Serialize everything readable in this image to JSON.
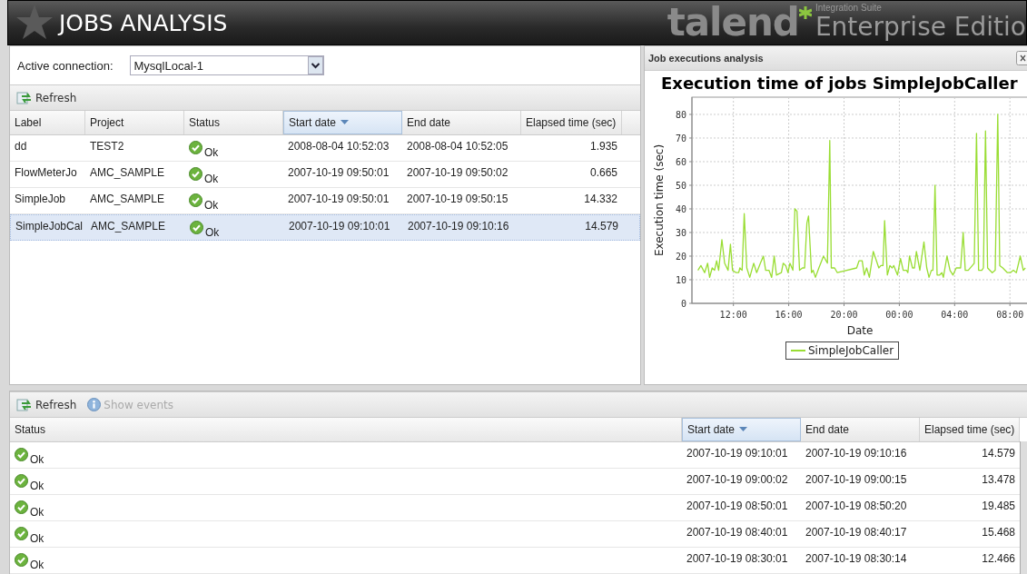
{
  "header": {
    "title": "JOBS ANALYSIS",
    "logo_word": "talend",
    "logo_suite": "Integration Suite",
    "logo_edition": "Enterprise Editio"
  },
  "connection": {
    "label": "Active connection:",
    "value": "MysqlLocal-1"
  },
  "jobs_toolbar": {
    "refresh": "Refresh"
  },
  "jobs_table": {
    "columns": [
      {
        "label": "Label",
        "sorted": false
      },
      {
        "label": "Project",
        "sorted": false
      },
      {
        "label": "Status",
        "sorted": false
      },
      {
        "label": "Start date",
        "sorted": true
      },
      {
        "label": "End date",
        "sorted": false
      },
      {
        "label": "Elapsed time (sec)",
        "sorted": false
      }
    ],
    "rows": [
      {
        "cells": [
          "dd",
          "TEST2",
          "Ok",
          "2008-08-04 10:52:03",
          "2008-08-04 10:52:05",
          "1.935"
        ],
        "selected": false
      },
      {
        "cells": [
          "FlowMeterJo",
          "AMC_SAMPLE",
          "Ok",
          "2007-10-19 09:50:01",
          "2007-10-19 09:50:02",
          "0.665"
        ],
        "selected": false
      },
      {
        "cells": [
          "SimpleJob",
          "AMC_SAMPLE",
          "Ok",
          "2007-10-19 09:50:01",
          "2007-10-19 09:50:15",
          "14.332"
        ],
        "selected": false
      },
      {
        "cells": [
          "SimpleJobCal",
          "AMC_SAMPLE",
          "Ok",
          "2007-10-19 09:10:01",
          "2007-10-19 09:10:16",
          "14.579"
        ],
        "selected": true
      }
    ]
  },
  "chart_panel": {
    "title": "Job executions analysis",
    "chart_data": {
      "type": "line",
      "title": "Execution time of jobs SimpleJobCaller",
      "xlabel": "Date",
      "ylabel": "Execution time (sec)",
      "grid": true,
      "xlim": [
        "2007-10-18 09:00",
        "2007-10-19 09:18"
      ],
      "ylim": [
        0,
        87.3
      ],
      "xticks": [
        {
          "value": "2007-10-18 12:00",
          "label": "12:00"
        },
        {
          "value": "2007-10-18 16:00",
          "label": "16:00"
        },
        {
          "value": "2007-10-18 20:00",
          "label": "20:00"
        },
        {
          "value": "2007-10-19 00:00",
          "label": "00:00"
        },
        {
          "value": "2007-10-19 04:00",
          "label": "04:00"
        },
        {
          "value": "2007-10-19 08:00",
          "label": "08:00"
        }
      ],
      "yticks": [
        0,
        10,
        20,
        30,
        40,
        50,
        60,
        70,
        80
      ],
      "x": [
        "2007-10-18 09:26",
        "2007-10-18 09:39",
        "2007-10-18 09:55",
        "2007-10-18 10:08",
        "2007-10-18 10:17",
        "2007-10-18 10:28",
        "2007-10-18 10:38",
        "2007-10-18 10:47",
        "2007-10-18 10:56",
        "2007-10-18 11:10",
        "2007-10-18 11:22",
        "2007-10-18 11:37",
        "2007-10-18 11:47",
        "2007-10-18 11:56",
        "2007-10-18 12:12",
        "2007-10-18 12:23",
        "2007-10-18 12:28",
        "2007-10-18 12:38",
        "2007-10-18 12:47",
        "2007-10-18 12:58",
        "2007-10-18 13:11",
        "2007-10-18 13:28",
        "2007-10-18 13:41",
        "2007-10-18 13:57",
        "2007-10-18 14:10",
        "2007-10-18 14:20",
        "2007-10-18 14:34",
        "2007-10-18 14:46",
        "2007-10-18 14:57",
        "2007-10-18 15:07",
        "2007-10-18 15:28",
        "2007-10-18 15:36",
        "2007-10-18 15:47",
        "2007-10-18 15:57",
        "2007-10-18 16:05",
        "2007-10-18 16:18",
        "2007-10-18 16:27",
        "2007-10-18 16:36",
        "2007-10-18 16:47",
        "2007-10-18 17:00",
        "2007-10-18 17:09",
        "2007-10-18 17:19",
        "2007-10-18 17:26",
        "2007-10-18 17:39",
        "2007-10-18 17:46",
        "2007-10-18 17:56",
        "2007-10-18 18:11",
        "2007-10-18 18:31",
        "2007-10-18 18:48",
        "2007-10-18 18:58",
        "2007-10-18 19:05",
        "2007-10-18 19:19",
        "2007-10-18 19:31",
        "2007-10-18 20:55",
        "2007-10-18 21:05",
        "2007-10-18 21:19",
        "2007-10-18 21:28",
        "2007-10-18 21:38",
        "2007-10-18 21:50",
        "2007-10-18 22:07",
        "2007-10-18 22:31",
        "2007-10-18 22:40",
        "2007-10-18 22:49",
        "2007-10-18 22:56",
        "2007-10-18 23:08",
        "2007-10-18 23:19",
        "2007-10-18 23:29",
        "2007-10-18 23:36",
        "2007-10-18 23:52",
        "2007-10-19 00:05",
        "2007-10-19 00:17",
        "2007-10-19 00:31",
        "2007-10-19 00:37",
        "2007-10-19 00:44",
        "2007-10-19 00:57",
        "2007-10-19 01:06",
        "2007-10-19 01:14",
        "2007-10-19 01:29",
        "2007-10-19 01:47",
        "2007-10-19 01:59",
        "2007-10-19 02:09",
        "2007-10-19 02:19",
        "2007-10-19 02:26",
        "2007-10-19 02:35",
        "2007-10-19 02:44",
        "2007-10-19 02:55",
        "2007-10-19 03:05",
        "2007-10-19 03:11",
        "2007-10-19 03:27",
        "2007-10-19 03:40",
        "2007-10-19 03:53",
        "2007-10-19 04:07",
        "2007-10-19 04:26",
        "2007-10-19 04:37",
        "2007-10-19 04:46",
        "2007-10-19 04:59",
        "2007-10-19 05:25",
        "2007-10-19 05:35",
        "2007-10-19 05:44",
        "2007-10-19 05:58",
        "2007-10-19 06:05",
        "2007-10-19 06:14",
        "2007-10-19 06:23",
        "2007-10-19 06:43",
        "2007-10-19 06:56",
        "2007-10-19 07:07",
        "2007-10-19 07:16",
        "2007-10-19 07:29",
        "2007-10-19 07:49",
        "2007-10-19 08:02",
        "2007-10-19 08:15",
        "2007-10-19 08:28",
        "2007-10-19 08:45",
        "2007-10-19 08:58",
        "2007-10-19 09:07"
      ],
      "series": [
        {
          "name": "SimpleJobCaller",
          "color": "#99dd33",
          "values": [
            14,
            16,
            13,
            17,
            11,
            15,
            14,
            18,
            14,
            27,
            17,
            14,
            25,
            14,
            13,
            13,
            15,
            14,
            38,
            15,
            11,
            17,
            13,
            17,
            20,
            14,
            14,
            11,
            20,
            12,
            13,
            17,
            16,
            13,
            17,
            14,
            40,
            39,
            14,
            15,
            15,
            34,
            37,
            13,
            14,
            11,
            15,
            20,
            17,
            69,
            15,
            15,
            13,
            15,
            18,
            18,
            12,
            15,
            11,
            22,
            15,
            16,
            16,
            35,
            12,
            16,
            15,
            16,
            12,
            19,
            14,
            14,
            13,
            20,
            15,
            15,
            22,
            14,
            26,
            15,
            11,
            14,
            14,
            50,
            12,
            12,
            13,
            11,
            20,
            14,
            12,
            15,
            15,
            30,
            14,
            14,
            17,
            72,
            14,
            14,
            15,
            73,
            15,
            13,
            14,
            80,
            16,
            15,
            13,
            13,
            14,
            13,
            20,
            14,
            15
          ]
        }
      ]
    }
  },
  "events_toolbar": {
    "refresh": "Refresh",
    "show_events": {
      "label": "Show events",
      "disabled": true
    }
  },
  "events_table": {
    "columns": [
      {
        "label": "Status",
        "sorted": false
      },
      {
        "label": "Start date",
        "sorted": true
      },
      {
        "label": "End date",
        "sorted": false
      },
      {
        "label": "Elapsed time (sec)",
        "sorted": false
      }
    ],
    "rows": [
      {
        "cells": [
          "Ok",
          "2007-10-19 09:10:01",
          "2007-10-19 09:10:16",
          "14.579"
        ],
        "selected": false
      },
      {
        "cells": [
          "Ok",
          "2007-10-19 09:00:02",
          "2007-10-19 09:00:15",
          "13.478"
        ],
        "selected": false
      },
      {
        "cells": [
          "Ok",
          "2007-10-19 08:50:01",
          "2007-10-19 08:50:20",
          "19.485"
        ],
        "selected": false
      },
      {
        "cells": [
          "Ok",
          "2007-10-19 08:40:01",
          "2007-10-19 08:40:17",
          "15.468"
        ],
        "selected": false
      },
      {
        "cells": [
          "Ok",
          "2007-10-19 08:30:01",
          "2007-10-19 08:30:14",
          "12.466"
        ],
        "selected": false
      }
    ]
  }
}
